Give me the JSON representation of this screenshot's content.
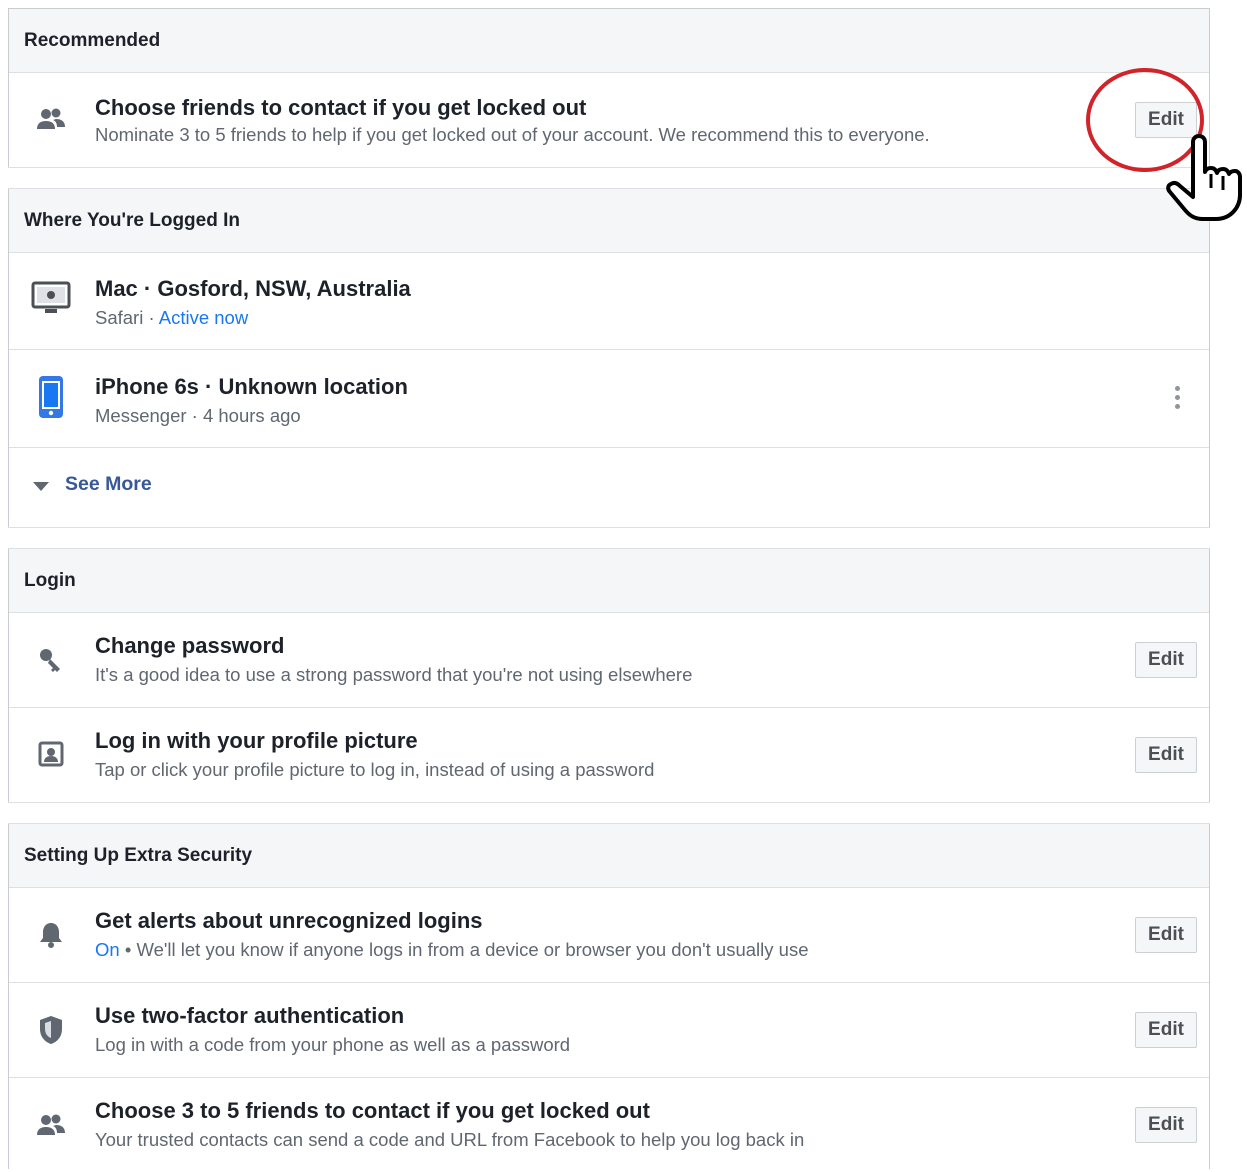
{
  "recommended": {
    "heading": "Recommended",
    "item": {
      "title": "Choose friends to contact if you get locked out",
      "subtitle": "Nominate 3 to 5 friends to help if you get locked out of your account. We recommend this to everyone.",
      "action": "Edit",
      "icon": "friends-icon"
    }
  },
  "logged_in": {
    "heading": "Where You're Logged In",
    "sessions": [
      {
        "title": "Mac · Gosford, NSW, Australia",
        "app": "Safari",
        "separator": " · ",
        "status": "Active now",
        "icon": "desktop-icon"
      },
      {
        "title": "iPhone 6s · Unknown location",
        "app": "Messenger",
        "separator": " · ",
        "status": "4 hours ago",
        "icon": "phone-icon"
      }
    ],
    "see_more": "See More"
  },
  "login": {
    "heading": "Login",
    "items": [
      {
        "title": "Change password",
        "subtitle": "It's a good idea to use a strong password that you're not using elsewhere",
        "action": "Edit",
        "icon": "key-icon"
      },
      {
        "title": "Log in with your profile picture",
        "subtitle": "Tap or click your profile picture to log in, instead of using a password",
        "action": "Edit",
        "icon": "profile-picture-icon"
      }
    ]
  },
  "extra_security": {
    "heading": "Setting Up Extra Security",
    "items": [
      {
        "title": "Get alerts about unrecognized logins",
        "status": "On",
        "bullet": " • ",
        "subtitle": "We'll let you know if anyone logs in from a device or browser you don't usually use",
        "action": "Edit",
        "icon": "bell-icon"
      },
      {
        "title": "Use two-factor authentication",
        "subtitle": "Log in with a code from your phone as well as a password",
        "action": "Edit",
        "icon": "shield-icon"
      },
      {
        "title": "Choose 3 to 5 friends to contact if you get locked out",
        "subtitle": "Your trusted contacts can send a code and URL from Facebook to help you log back in",
        "action": "Edit",
        "icon": "friends-icon"
      }
    ]
  },
  "colors": {
    "link_blue": "#1877f2",
    "see_more_blue": "#385898",
    "annotation_red": "#d0232a"
  }
}
